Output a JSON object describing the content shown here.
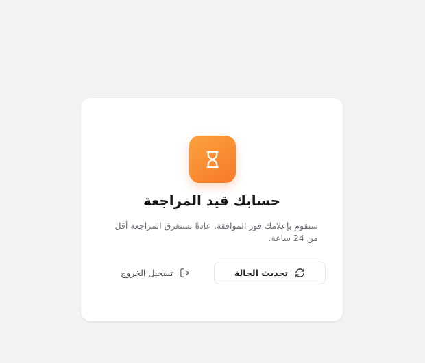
{
  "status_card": {
    "icon": "hourglass-icon",
    "title": "حسابك قيد المراجعة",
    "description": "سنقوم بإعلامك فور الموافقة. عادةً تستغرق المراجعة أقل من 24 ساعة.",
    "refresh_button": {
      "label": "تحديث الحالة",
      "icon": "refresh-icon"
    },
    "logout_link": {
      "label": "تسجيل الخروج",
      "icon": "logout-icon"
    }
  },
  "colors": {
    "page_background": "#f1f2f3",
    "card_background": "#ffffff",
    "accent_gradient_start": "#fba33d",
    "accent_gradient_end": "#f7782a",
    "title_text": "#16181d",
    "body_text": "#6b7078"
  }
}
